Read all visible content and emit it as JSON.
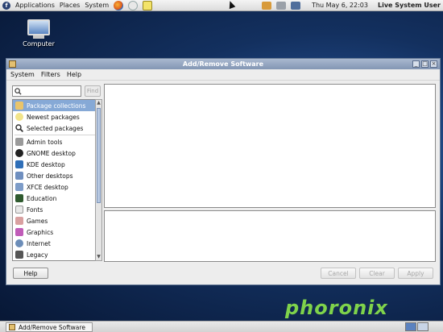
{
  "top_panel": {
    "menus": [
      "Applications",
      "Places",
      "System"
    ],
    "clock": "Thu May  6, 22:03",
    "user": "Live System User"
  },
  "desktop": {
    "icons": [
      {
        "label": "Computer"
      }
    ]
  },
  "window": {
    "title": "Add/Remove Software",
    "menubar": [
      "System",
      "Filters",
      "Help"
    ],
    "search": {
      "value": "",
      "placeholder": "",
      "find_label": "Find"
    },
    "groups": [
      {
        "label": "Package collections",
        "icon": "package-collections-icon",
        "selected": true
      },
      {
        "label": "Newest packages",
        "icon": "newest-packages-icon"
      },
      {
        "label": "Selected packages",
        "icon": "magnifier-icon"
      },
      {
        "label": "Admin tools",
        "icon": "admin-tools-icon"
      },
      {
        "label": "GNOME desktop",
        "icon": "gnome-icon"
      },
      {
        "label": "KDE desktop",
        "icon": "kde-icon"
      },
      {
        "label": "Other desktops",
        "icon": "other-desktops-icon"
      },
      {
        "label": "XFCE desktop",
        "icon": "xfce-icon"
      },
      {
        "label": "Education",
        "icon": "education-icon"
      },
      {
        "label": "Fonts",
        "icon": "fonts-icon"
      },
      {
        "label": "Games",
        "icon": "games-icon"
      },
      {
        "label": "Graphics",
        "icon": "graphics-icon"
      },
      {
        "label": "Internet",
        "icon": "internet-icon"
      },
      {
        "label": "Legacy",
        "icon": "legacy-icon"
      }
    ],
    "buttons": {
      "help": "Help",
      "cancel": "Cancel",
      "clear": "Clear",
      "apply": "Apply"
    }
  },
  "watermark": "phoronix",
  "taskbar": {
    "task": "Add/Remove Software"
  },
  "colors": {
    "selection": "#86a9d6",
    "titlebar": "#8fa0bd",
    "watermark": "#7fd34b"
  }
}
